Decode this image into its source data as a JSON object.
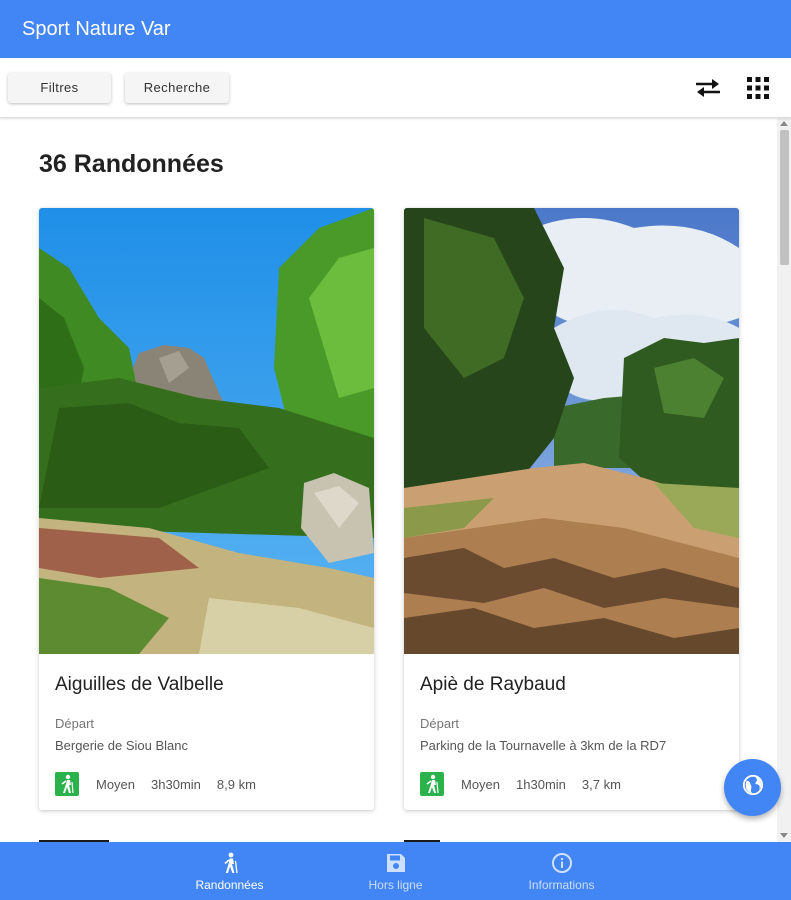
{
  "app": {
    "title": "Sport Nature Var"
  },
  "toolbar": {
    "filters_label": "Filtres",
    "search_label": "Recherche",
    "icons": [
      "swap-arrows-icon",
      "grid-icon"
    ]
  },
  "list": {
    "heading": "36 Randonnées",
    "start_label": "Départ",
    "cards": [
      {
        "title": "Aiguilles de Valbelle",
        "start": "Bergerie de Siou Blanc",
        "difficulty": "Moyen",
        "duration": "3h30min",
        "distance": "8,9 km",
        "icon": "hiker-icon"
      },
      {
        "title": "Apiè de Raybaud",
        "start": "Parking de la Tournavelle à 3km de la RD7",
        "difficulty": "Moyen",
        "duration": "1h30min",
        "distance": "3,7 km",
        "icon": "hiker-icon"
      }
    ]
  },
  "fab": {
    "icon": "globe-icon"
  },
  "bottom_nav": {
    "items": [
      {
        "label": "Randonnées",
        "icon": "hiker-icon",
        "active": true
      },
      {
        "label": "Hors ligne",
        "icon": "save-icon",
        "active": false
      },
      {
        "label": "Informations",
        "icon": "info-icon",
        "active": false
      }
    ]
  },
  "colors": {
    "primary": "#4285f4",
    "badge": "#2bb24c",
    "text": "#212121"
  }
}
